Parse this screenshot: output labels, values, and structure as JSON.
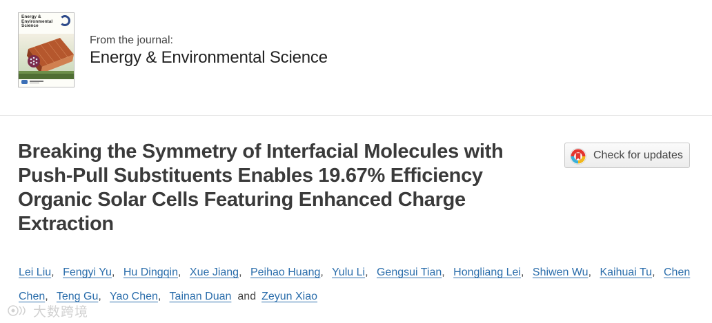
{
  "journal": {
    "cover_title": "Energy & Environmental Science",
    "from_label": "From the journal:",
    "name": "Energy & Environmental Science"
  },
  "article": {
    "title": "Breaking the Symmetry of Interfacial Molecules with Push-Pull Substituents Enables 19.67% Efficiency Organic Solar Cells Featuring Enhanced Charge Extraction"
  },
  "check_updates": {
    "label": "Check for updates"
  },
  "authors": {
    "list": [
      "Lei Liu",
      "Fengyi Yu",
      "Hu Dingqin",
      "Xue Jiang",
      "Peihao Huang",
      "Yulu Li",
      "Gengsui Tian",
      "Hongliang Lei",
      "Shiwen Wu",
      "Kaihuai Tu",
      "Chen Chen",
      "Teng Gu",
      "Yao Chen",
      "Tainan Duan",
      "Zeyun Xiao"
    ],
    "separator": ",",
    "and_word": "and"
  },
  "watermark": {
    "text": "大数跨境"
  },
  "colors": {
    "link": "#2a6dab",
    "title": "#3a3a3a",
    "journal_text": "#222222"
  }
}
